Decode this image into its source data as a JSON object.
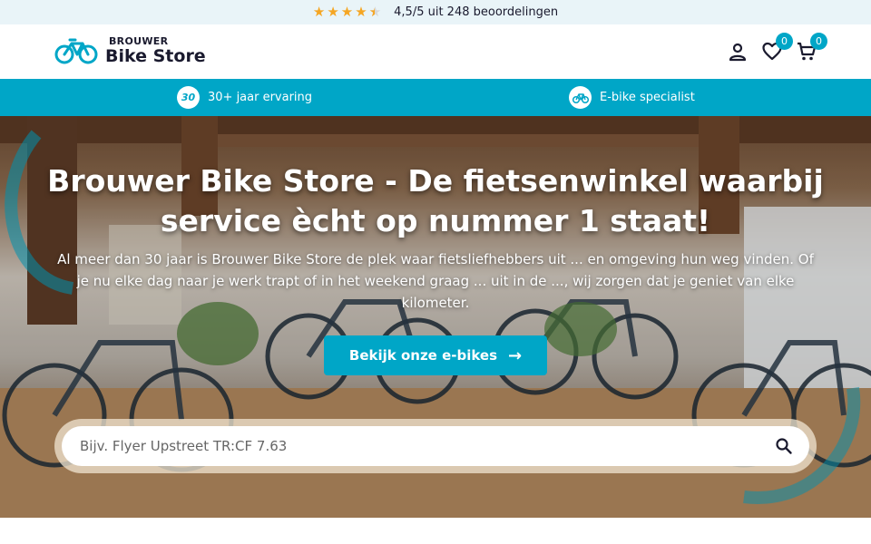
{
  "rating": {
    "stars_value": 4.5,
    "stars_max": 5,
    "text": "4,5/5 uit 248 beoordelingen"
  },
  "header": {
    "logo_small": "BROUWER",
    "logo_big": "Bike Store",
    "wishlist_count": "0",
    "cart_count": "0"
  },
  "usp": [
    {
      "badge": "30",
      "label": "30+ jaar ervaring"
    },
    {
      "label": "E-bike specialist"
    }
  ],
  "hero": {
    "title": "Brouwer Bike Store - De fietsenwinkel waarbij service ècht op nummer 1 staat!",
    "subtitle": "Al meer dan 30 jaar is Brouwer Bike Store de plek waar fietsliefhebbers uit ... en omgeving hun weg vinden. Of je nu elke dag naar je werk trapt of in het weekend graag ... uit in de ..., wij zorgen dat je geniet van elke kilometer.",
    "cta_label": "Bekijk onze e-bikes"
  },
  "search": {
    "placeholder": "Bijv. Flyer Upstreet TR:CF 7.63"
  },
  "colors": {
    "accent": "#00a6c7",
    "star": "#f5a623",
    "rating_bg": "#e9f4f8"
  }
}
